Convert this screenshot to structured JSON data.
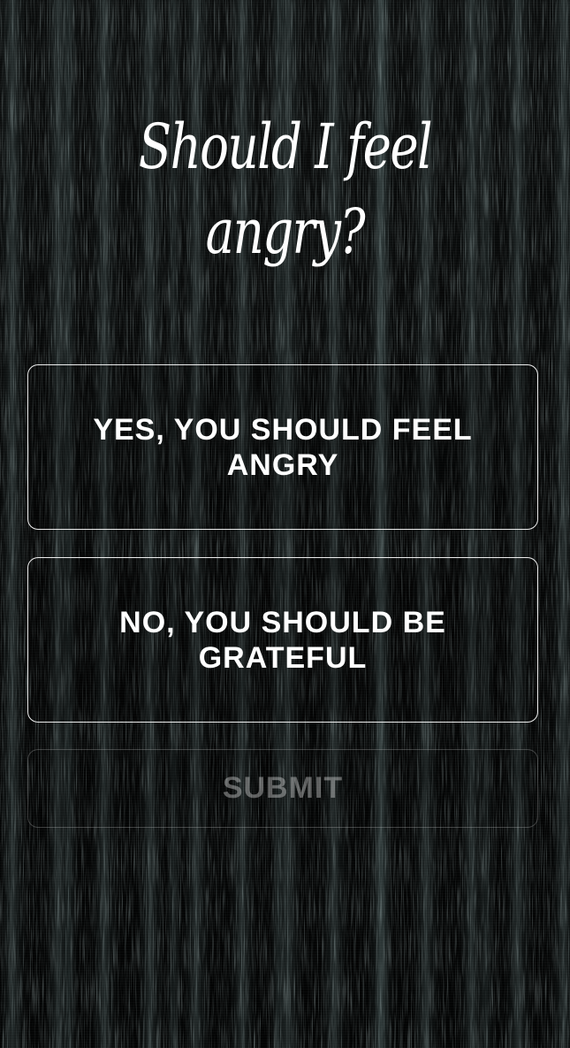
{
  "question": {
    "line1": "Should I feel",
    "line2": "angry?"
  },
  "options": [
    {
      "label": "YES, YOU SHOULD FEEL ANGRY"
    },
    {
      "label": "NO, YOU SHOULD BE GRATEFUL"
    }
  ],
  "submit": {
    "label": "SUBMIT",
    "state": "disabled"
  }
}
